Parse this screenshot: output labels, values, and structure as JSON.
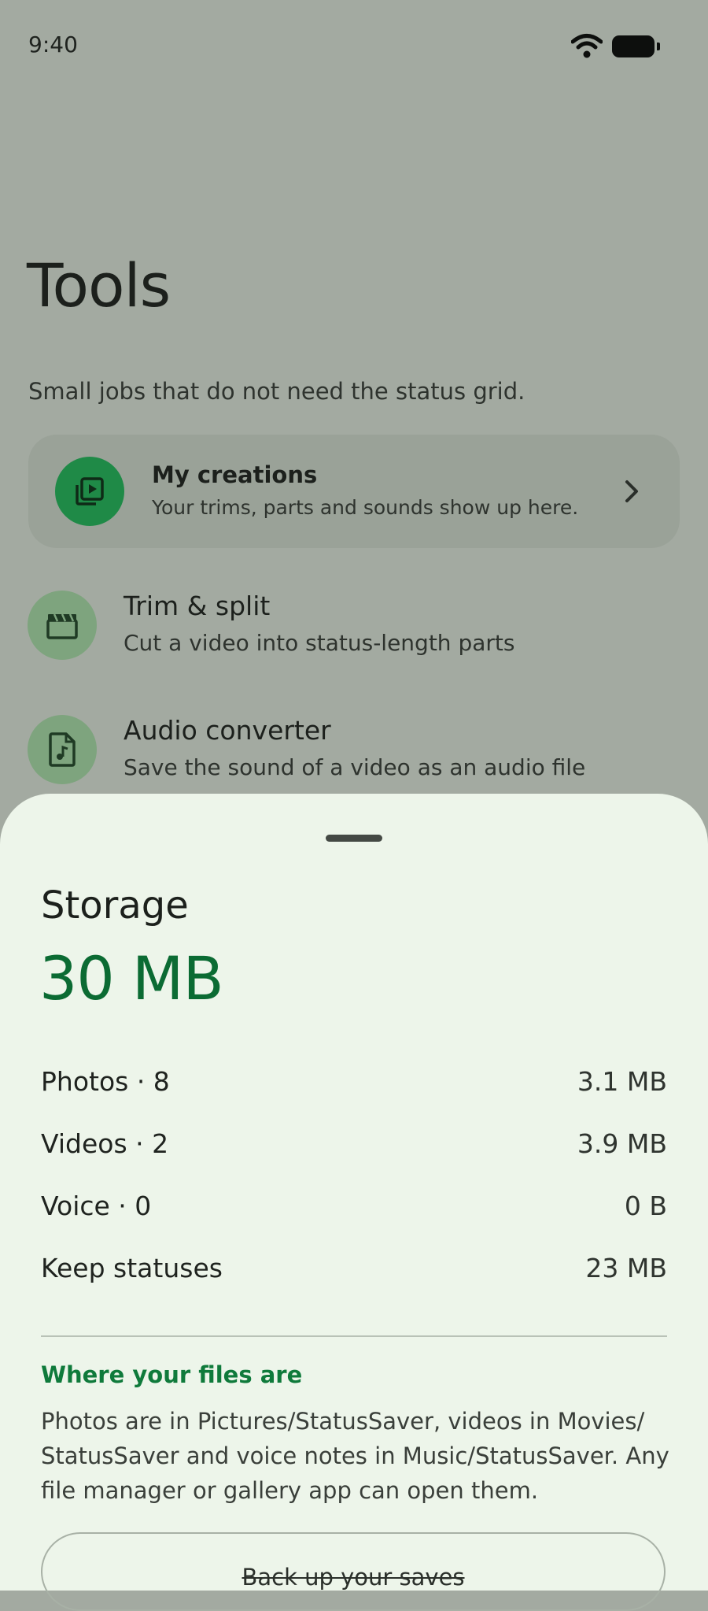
{
  "status_bar": {
    "time": "9:40"
  },
  "page": {
    "title": "Tools",
    "subtitle": "Small jobs that do not need the status grid."
  },
  "creations_card": {
    "title": "My creations",
    "subtitle": "Your trims, parts and sounds show up here."
  },
  "tools": [
    {
      "title": "Trim & split",
      "subtitle": "Cut a video into status-length parts",
      "icon": "clapperboard-icon"
    },
    {
      "title": "Audio converter",
      "subtitle": "Save the sound of a video as an audio file",
      "icon": "audio-file-icon"
    }
  ],
  "storage_sheet": {
    "title": "Storage",
    "total": "30 MB",
    "rows": [
      {
        "label": "Photos · 8",
        "value": "3.1 MB"
      },
      {
        "label": "Videos · 2",
        "value": "3.9 MB"
      },
      {
        "label": "Voice · 0",
        "value": "0 B"
      },
      {
        "label": "Keep statuses",
        "value": "23 MB"
      }
    ],
    "where_heading": "Where your files are",
    "where_body": "Photos are in Pictures/StatusSaver, videos in Movies/ StatusSaver and voice notes in Music/StatusSaver. Any file manager or gallery app can open them.",
    "backup_label": "Back up your saves"
  },
  "colors": {
    "accent": "#0b6b33",
    "creations_icon_bg": "#1f8a47",
    "tool_icon_bg": "#7ea47e",
    "sheet_bg": "#edf5ea",
    "scrim_bg": "#a3aaa1"
  }
}
